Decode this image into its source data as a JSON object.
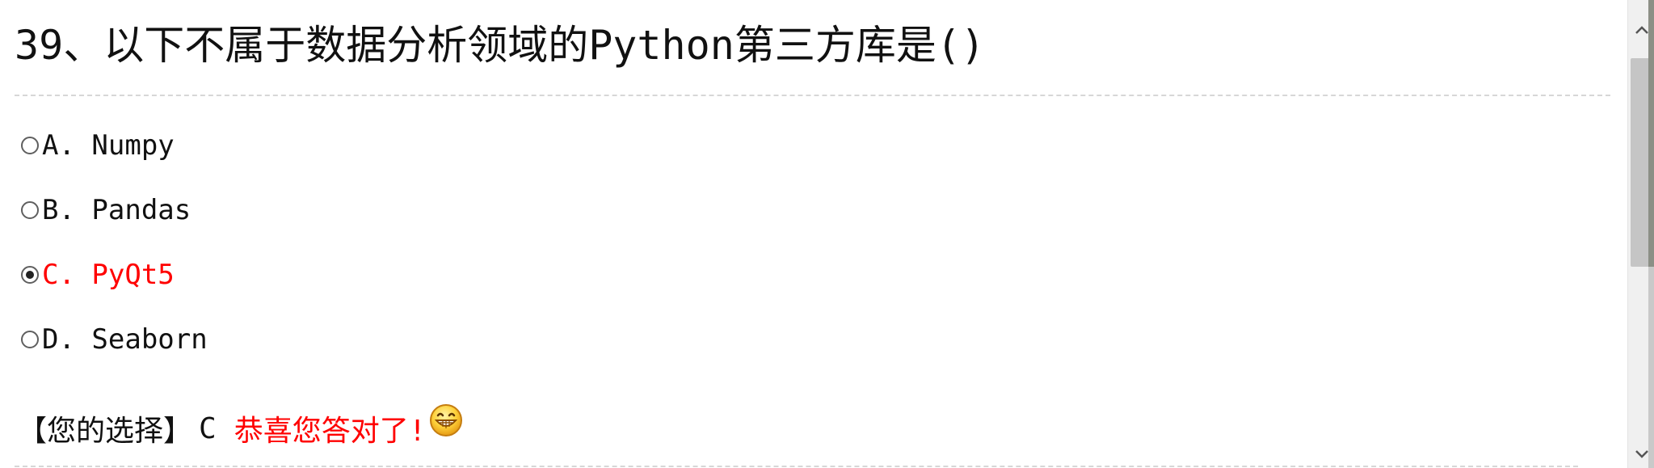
{
  "question": {
    "title": "39、以下不属于数据分析领域的Python第三方库是()"
  },
  "options": [
    {
      "label": "A. Numpy",
      "selected": false
    },
    {
      "label": "B. Pandas",
      "selected": false
    },
    {
      "label": "C. PyQt5",
      "selected": true
    },
    {
      "label": "D. Seaborn",
      "selected": false
    }
  ],
  "result": {
    "prefix": "【您的选择】",
    "choice": "C",
    "message": "恭喜您答对了!",
    "emoji": "grinning-face-icon"
  },
  "colors": {
    "selected": "#ff0000",
    "correct_message": "#ff0000",
    "divider": "#d7d7d7",
    "scrollbar_track": "#f0f0f0",
    "scrollbar_thumb": "#c5c5c5"
  }
}
